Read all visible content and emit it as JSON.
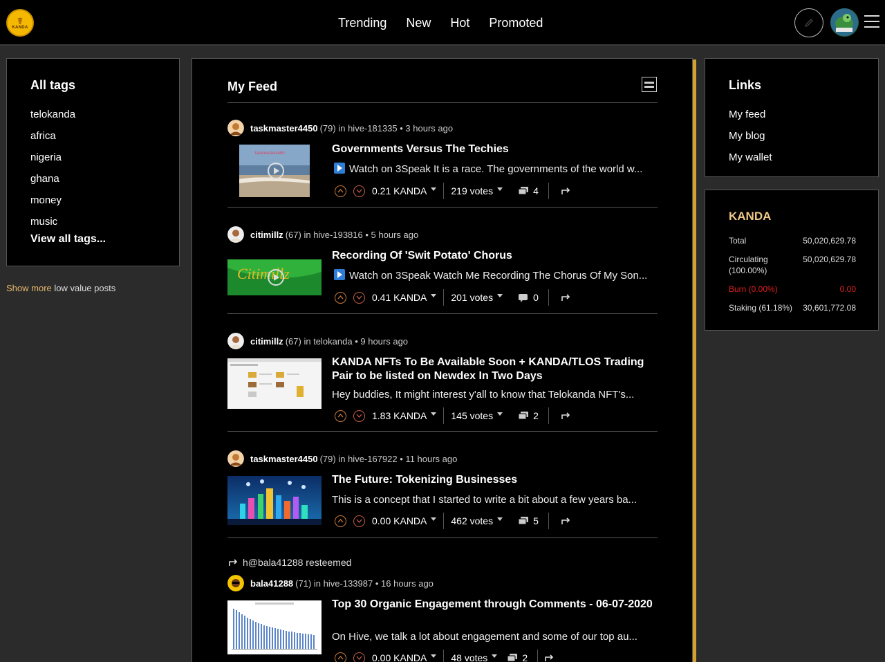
{
  "header": {
    "logo_text": "KANDA",
    "nav": [
      "Trending",
      "New",
      "Hot",
      "Promoted"
    ]
  },
  "left": {
    "title": "All tags",
    "tags": [
      "telokanda",
      "africa",
      "nigeria",
      "ghana",
      "money",
      "music"
    ],
    "view_all": "View all tags...",
    "low_value_show": "Show more",
    "low_value_rest": " low value posts"
  },
  "feed": {
    "title": "My Feed",
    "posts": [
      {
        "author": "taskmaster4450",
        "rep": "(79)",
        "in_label": "in",
        "community": "hive-181335",
        "time": "• 3 hours ago",
        "title": "Governments Versus The Techies",
        "excerpt": "Watch on 3Speak It is a race. The governments of the world w...",
        "payout": "0.21 KANDA",
        "votes": "219 votes",
        "comments": "4",
        "video": true
      },
      {
        "author": "citimillz",
        "rep": "(67)",
        "in_label": "in",
        "community": "hive-193816",
        "time": "• 5 hours ago",
        "title": "Recording Of 'Swit Potato' Chorus",
        "excerpt": "Watch on 3Speak Watch Me Recording The Chorus Of My Son...",
        "payout": "0.41 KANDA",
        "votes": "201 votes",
        "comments": "0",
        "video": true
      },
      {
        "author": "citimillz",
        "rep": "(67)",
        "in_label": "in",
        "community": "telokanda",
        "time": "• 9 hours ago",
        "title": "KANDA NFTs To Be Available Soon + KANDA/TLOS Trading Pair to be listed on Newdex In Two Days",
        "excerpt": "Hey buddies, It might interest y'all to know that Telokanda NFT's...",
        "payout": "1.83 KANDA",
        "votes": "145 votes",
        "comments": "2",
        "video": false
      },
      {
        "author": "taskmaster4450",
        "rep": "(79)",
        "in_label": "in",
        "community": "hive-167922",
        "time": "• 11 hours ago",
        "title": "The Future: Tokenizing Businesses",
        "excerpt": "This is a concept that I started to write a bit about a few years ba...",
        "payout": "0.00 KANDA",
        "votes": "462 votes",
        "comments": "5",
        "video": false
      },
      {
        "resteemed_by": "h@bala41288 resteemed",
        "author": "bala41288",
        "rep": "(71)",
        "in_label": "in",
        "community": "hive-133987",
        "time": "• 16 hours ago",
        "title": "Top 30 Organic Engagement through Comments - 06-07-2020",
        "excerpt": "On Hive, we talk a lot about engagement and some of our top au...",
        "payout": "0.00 KANDA",
        "votes": "48 votes",
        "comments": "2",
        "video": false
      }
    ]
  },
  "links": {
    "title": "Links",
    "items": [
      "My feed",
      "My blog",
      "My wallet"
    ]
  },
  "token": {
    "title": "KANDA",
    "rows": [
      {
        "label": "Total",
        "value": "50,020,629.78"
      },
      {
        "label": "Circulating (100.00%)",
        "value": "50,020,629.78"
      },
      {
        "label": "Burn (0.00%)",
        "value": "0.00"
      },
      {
        "label": "Staking (61.18%)",
        "value": "30,601,772.08"
      }
    ]
  },
  "colors": {
    "accent": "#d4a02a",
    "burn": "#e02020",
    "token_title": "#f0c98a"
  }
}
